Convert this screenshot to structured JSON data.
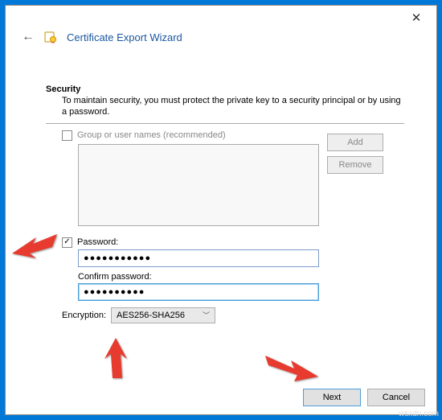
{
  "window": {
    "title": "Certificate Export Wizard",
    "close_label": "✕"
  },
  "section": {
    "heading": "Security",
    "description": "To maintain security, you must protect the private key to a security principal or by using a password."
  },
  "groupnames": {
    "checkbox_label": "Group or user names (recommended)",
    "add_btn": "Add",
    "remove_btn": "Remove",
    "checked": false
  },
  "password": {
    "checkbox_label": "Password:",
    "checked": true,
    "value": "●●●●●●●●●●●",
    "confirm_label": "Confirm password:",
    "confirm_value": "●●●●●●●●●●"
  },
  "encryption": {
    "label": "Encryption:",
    "value": "AES256-SHA256"
  },
  "footer": {
    "next": "Next",
    "cancel": "Cancel"
  },
  "watermark": "wsxdn.com"
}
